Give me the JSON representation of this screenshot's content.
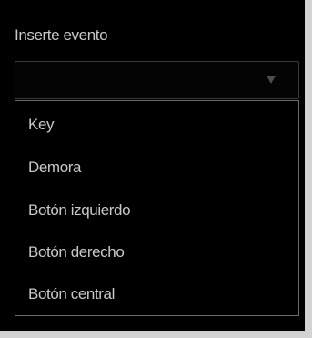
{
  "event_label": "Inserte evento",
  "select": {
    "value": "",
    "arrow_icon": "dropdown-arrow-icon"
  },
  "options": [
    "Key",
    "Demora",
    "Botón izquierdo",
    "Botón derecho",
    "Botón central"
  ],
  "colors": {
    "background": "#000000",
    "frame": "#d2d2d2",
    "text": "#c8c8c8",
    "select_border": "#3a3a3a",
    "dropdown_border": "#6a6a6a",
    "arrow": "#4d4d4d"
  }
}
